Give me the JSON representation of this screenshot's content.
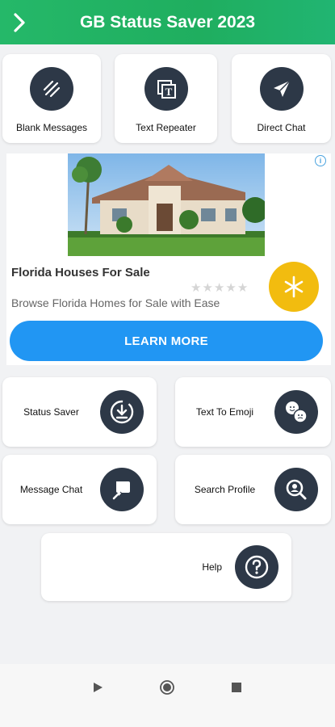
{
  "header": {
    "title": "GB Status Saver 2023",
    "back_icon": "chevron-right-icon"
  },
  "top_tools": [
    {
      "label": "Blank Messages",
      "icon": "slashes-icon"
    },
    {
      "label": "Text Repeater",
      "icon": "text-frame-icon"
    },
    {
      "label": "Direct Chat",
      "icon": "paper-plane-icon"
    }
  ],
  "ad": {
    "title": "Florida Houses For Sale",
    "description": "Browse Florida Homes for Sale with Ease",
    "cta": "LEARN MORE",
    "info_icon": "info-icon",
    "rating_stars": 5,
    "rating_filled": 0,
    "accent_color": "#2196f3"
  },
  "tools": [
    {
      "label": "Status Saver",
      "icon": "download-circle-icon"
    },
    {
      "label": "Text To Emoji",
      "icon": "emoji-icon"
    },
    {
      "label": "Message Chat",
      "icon": "chat-edit-icon"
    },
    {
      "label": "Search Profile",
      "icon": "search-profile-icon"
    },
    {
      "label": "Help",
      "icon": "question-icon"
    }
  ],
  "nav": {
    "back_icon": "back-triangle-icon",
    "home_icon": "home-circle-icon",
    "recents_icon": "recents-square-icon"
  },
  "colors": {
    "header_green": "#25b869",
    "icon_dark": "#2d3847",
    "page_bg": "#f1f2f4"
  }
}
